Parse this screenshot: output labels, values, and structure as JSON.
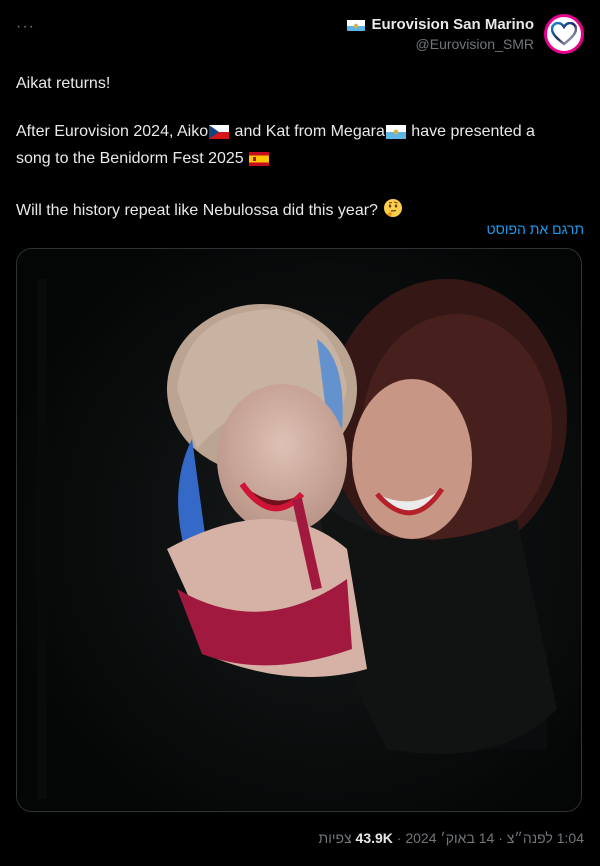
{
  "header": {
    "more_label": "···",
    "author_name": "Eurovision San Marino",
    "author_handle": "@Eurovision_SMR"
  },
  "tweet": {
    "line1": "Aikat returns!",
    "line2a": "After Eurovision 2024, Aiko",
    "line2b": " and Kat from Megara",
    "line2c": " have presented a",
    "line3a": "song to the Benidorm Fest 2025 ",
    "line4": "Will the history repeat like Nebulossa did this year? ",
    "emojis": [
      "czech-flag-icon",
      "san-marino-flag-icon",
      "spain-flag-icon",
      "thinking-face-icon"
    ]
  },
  "translate_label": "תרגם את הפוסט",
  "meta": {
    "time": "1:04",
    "relative": "לפנה״צ",
    "date": "14 באוק׳ 2024",
    "views_count": "43.9K",
    "views_label": "צפיות"
  },
  "colors": {
    "background": "#000000",
    "text": "#e7e9ea",
    "muted": "#71767b",
    "link": "#1d9bf0",
    "border": "#2f3336"
  }
}
